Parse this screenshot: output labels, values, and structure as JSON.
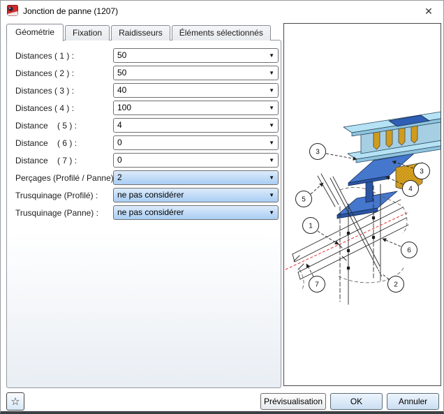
{
  "window": {
    "title": "Jonction de panne (1207)"
  },
  "icons": {
    "close": "✕",
    "dropdown": "▼",
    "favorite": "☆"
  },
  "tabs": [
    {
      "label": "Géométrie",
      "active": true
    },
    {
      "label": "Fixation",
      "active": false
    },
    {
      "label": "Raidisseurs",
      "active": false
    },
    {
      "label": "Éléments sélectionnés",
      "active": false
    }
  ],
  "form": {
    "rows": [
      {
        "label": "Distances ( 1 ) :",
        "value": "50",
        "highlight": false
      },
      {
        "label": "Distances ( 2 ) :",
        "value": "50",
        "highlight": false
      },
      {
        "label": "Distances ( 3 ) :",
        "value": "40",
        "highlight": false
      },
      {
        "label": "Distances ( 4 ) :",
        "value": "100",
        "highlight": false
      },
      {
        "label": "Distance    ( 5 ) :",
        "value": "4",
        "highlight": false
      },
      {
        "label": "Distance    ( 6 ) :",
        "value": "0",
        "highlight": false
      },
      {
        "label": "Distance    ( 7 ) :",
        "value": "0",
        "highlight": false
      },
      {
        "label": "Perçages (Profilé / Panne)",
        "value": "2",
        "highlight": true
      },
      {
        "label": "Trusquinage (Profilé) :",
        "value": "ne pas considérer",
        "highlight": true
      },
      {
        "label": "Trusquinage (Panne) :",
        "value": "ne pas considérer",
        "highlight": true
      }
    ]
  },
  "preview": {
    "description": "Technical drawing of purlin joint: 3D isometric beam connection with stiffeners and 2D schematic with dimension callouts",
    "callouts": [
      "3",
      "3",
      "4",
      "5",
      "1",
      "7",
      "6",
      "2"
    ]
  },
  "footer": {
    "preview_label": "Prévisualisation",
    "ok_label": "OK",
    "cancel_label": "Annuler"
  },
  "colors": {
    "purlin_light": "#b5e2f4",
    "purlin_shade": "#8fc3dd",
    "purlin_web": "#a6cfe4",
    "beam_blue": "#4577cd",
    "beam_dark": "#2a55a5",
    "plate_blue": "#2f5fb5",
    "stiffener_orange": "#d9a31f",
    "centerline_red": "#e03333",
    "combo_hl_top": "#dcebfb",
    "combo_hl_bottom": "#a9cdf3"
  }
}
